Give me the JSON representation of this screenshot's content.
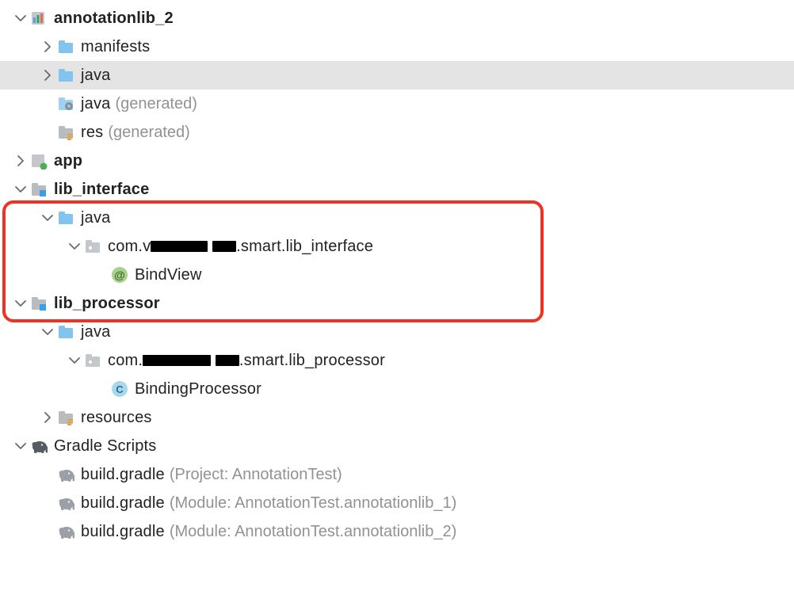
{
  "tree": {
    "annotationlib_2": "annotationlib_2",
    "manifests": "manifests",
    "java": "java",
    "generated": "(generated)",
    "res": "res",
    "app": "app",
    "lib_interface": "lib_interface",
    "pkg_interface_pre": "com.v",
    "pkg_interface_mid": "",
    "pkg_interface_post": ".smart.lib_interface",
    "bindview": "BindView",
    "lib_processor": "lib_processor",
    "pkg_processor_pre": "com.",
    "pkg_processor_post": ".smart.lib_processor",
    "bindingprocessor": "BindingProcessor",
    "resources": "resources",
    "gradle_scripts": "Gradle Scripts",
    "build_gradle": "build.gradle",
    "hint_project": "(Project: AnnotationTest)",
    "hint_mod1": "(Module: AnnotationTest.annotationlib_1)",
    "hint_mod2": "(Module: AnnotationTest.annotationlib_2)"
  }
}
